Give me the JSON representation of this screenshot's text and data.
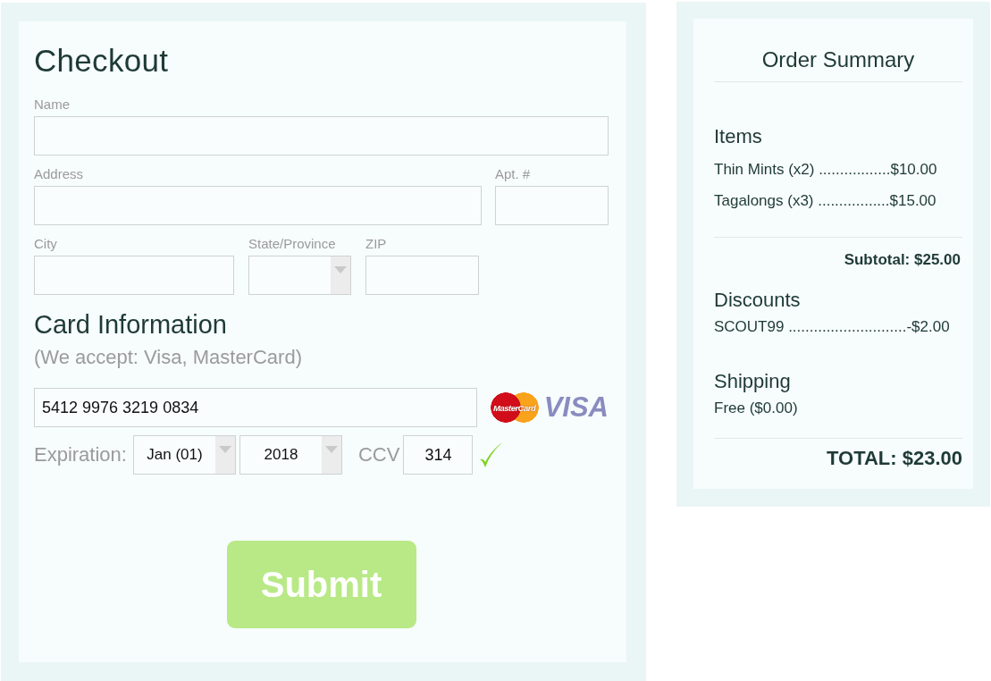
{
  "checkout": {
    "title": "Checkout",
    "field_rows": [
      [
        {
          "kind": "text",
          "label": "Name"
        }
      ],
      [
        {
          "kind": "text",
          "label": "Address"
        },
        {
          "kind": "text",
          "label": "Apt. #"
        }
      ],
      [
        {
          "kind": "text",
          "label": "City"
        },
        {
          "kind": "select",
          "label": "State/Province"
        },
        {
          "kind": "text",
          "label": "ZIP"
        }
      ]
    ],
    "card": {
      "title": "Card Information",
      "note": "(We accept: Visa, MasterCard)",
      "number": "5412 9976 3219 0834",
      "logos": [
        {
          "kind": "mastercard",
          "text": "MasterCard"
        },
        {
          "kind": "visa",
          "text": "VISA"
        }
      ],
      "expiration_label": "Expiration:",
      "month": "Jan (01)",
      "year": "2018",
      "ccv_label": "CCV",
      "ccv": "314",
      "ccv_valid": true
    },
    "submit": "Submit"
  },
  "summary": {
    "title": "Order Summary",
    "sections": [
      {
        "kind": "list",
        "heading": "Items",
        "lines": [
          "Thin Mints (x2) .................$10.00",
          "Tagalongs (x3) .................$15.00"
        ]
      },
      {
        "kind": "subtotal",
        "text": "Subtotal: $25.00"
      },
      {
        "kind": "list",
        "heading": "Discounts",
        "lines": [
          "SCOUT99 ............................-$2.00"
        ]
      },
      {
        "kind": "list",
        "heading": "Shipping",
        "lines": [
          "Free ($0.00)"
        ]
      },
      {
        "kind": "total",
        "text": "TOTAL: $23.00"
      }
    ]
  }
}
